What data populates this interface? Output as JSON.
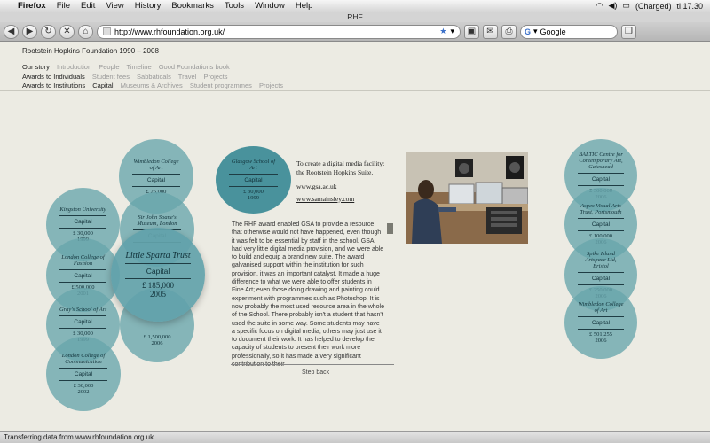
{
  "menubar": {
    "app": "Firefox",
    "items": [
      "File",
      "Edit",
      "View",
      "History",
      "Bookmarks",
      "Tools",
      "Window",
      "Help"
    ],
    "battery": "(Charged)",
    "clock": "ti 17.30"
  },
  "window": {
    "title": "RHF"
  },
  "toolbar": {
    "url": "http://www.rhfoundation.org.uk/",
    "search_placeholder": "Google"
  },
  "site": {
    "header": "Rootstein Hopkins Foundation 1990 – 2008",
    "nav": [
      {
        "label": "Our story",
        "items": [
          "Introduction",
          "People",
          "Timeline",
          "Good Foundations book"
        ]
      },
      {
        "label": "Awards to Individuals",
        "items": [
          "Student fees",
          "Sabbaticals",
          "Travel",
          "Projects"
        ]
      },
      {
        "label": "Awards to Institutions",
        "items": [
          "Capital",
          "Museums & Archives",
          "Student programmes",
          "Projects"
        ]
      }
    ]
  },
  "circles": [
    {
      "name": "Wimbledon College of Art",
      "type": "Capital",
      "amount": "£ 25,000",
      "year": ""
    },
    {
      "name": "Kingston University",
      "type": "Capital",
      "amount": "£ 30,000",
      "year": "1999"
    },
    {
      "name": "Sir John Soane's Museum, London",
      "type": "Capital",
      "amount": "",
      "year": ""
    },
    {
      "name": "London College of Fashion",
      "type": "Capital",
      "amount": "£ 500,000",
      "year": "2001"
    },
    {
      "name": "Gray's School of Art",
      "type": "Capital",
      "amount": "£ 30,000",
      "year": "1999"
    },
    {
      "name": "",
      "type": "",
      "amount": "£ 1,500,000",
      "year": "2006"
    },
    {
      "name": "London College of Communication",
      "type": "Capital",
      "amount": "£ 30,000",
      "year": "2002"
    },
    {
      "name": "Little Sparta Trust",
      "type": "Capital",
      "amount": "£ 185,000",
      "year": "2005"
    },
    {
      "name": "Glasgow School of Art",
      "type": "Capital",
      "amount": "£ 30,000",
      "year": "1999"
    },
    {
      "name": "BALTIC Centre for Contemporary Art, Gateshead",
      "type": "Capital",
      "amount": "£ 500,000",
      "year": "2006"
    },
    {
      "name": "Aspex Visual Arts Trust, Portsmouth",
      "type": "Capital",
      "amount": "£ 100,000",
      "year": "2006"
    },
    {
      "name": "Spike Island Artspace Ltd, Bristol",
      "type": "Capital",
      "amount": "£ 250,000",
      "year": "2006"
    },
    {
      "name": "Wimbledon College of Art",
      "type": "Capital",
      "amount": "£ 501,255",
      "year": "2006"
    }
  ],
  "detail": {
    "purpose": "To create a digital media facility: the Rootstein Hopkins Suite.",
    "link1": "www.gsa.ac.uk",
    "link2": "www.samainsley.com",
    "body": "The RHF award enabled GSA to provide a resource that otherwise would not have happened, even though it was felt to be essential by staff in the school. GSA had very little digital media provision, and we were able to build and equip a brand new suite. The award galvanised support within the institution for such provision, it was an important catalyst. It made a huge difference to what we were able to offer students in Fine Art; even those doing drawing and painting could experiment with programmes such as Photoshop. It is now probably the most used resource area in the whole of the School. There probably isn't a student that hasn't used the suite in some way. Some students may have a specific focus on digital media; others may just use it to document their work. It has helped to develop the capacity of students to present their work more professionally, so it has made a very significant contribution to their",
    "step_back": "Step back"
  },
  "status": "Transferring data from www.rhfoundation.org.uk..."
}
